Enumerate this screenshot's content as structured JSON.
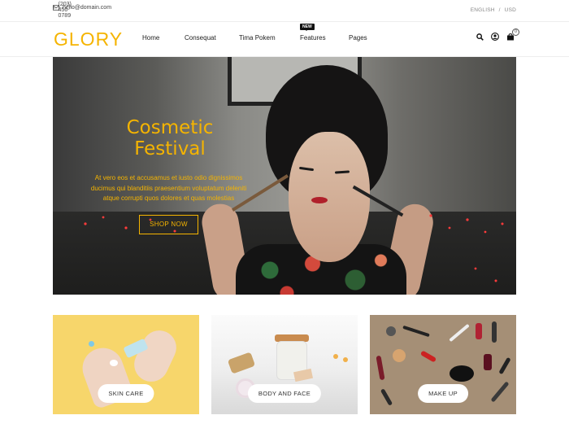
{
  "topbar": {
    "phone": "+1 (203) 456-0789",
    "email": "hello@domain.com",
    "language": "ENGLISH",
    "separator": "/",
    "currency": "USD"
  },
  "header": {
    "logo": "GLORY",
    "nav": [
      {
        "label": "Home"
      },
      {
        "label": "Consequat"
      },
      {
        "label": "Tima Pokem"
      },
      {
        "label": "Features",
        "badge": "NEW"
      },
      {
        "label": "Pages"
      }
    ],
    "cart_count": "0"
  },
  "hero": {
    "title": "Cosmetic Festival",
    "description": "At vero eos et accusamus et iusto odio dignissimos ducimus qui blanditiis praesentium voluptatum deleniti atque corrupti quos dolores et quas molestias",
    "button": "SHOP NOW"
  },
  "categories": [
    {
      "label": "SKIN CARE"
    },
    {
      "label": "BODY AND FACE"
    },
    {
      "label": "MAKE UP"
    }
  ],
  "colors": {
    "accent": "#f5b400"
  }
}
